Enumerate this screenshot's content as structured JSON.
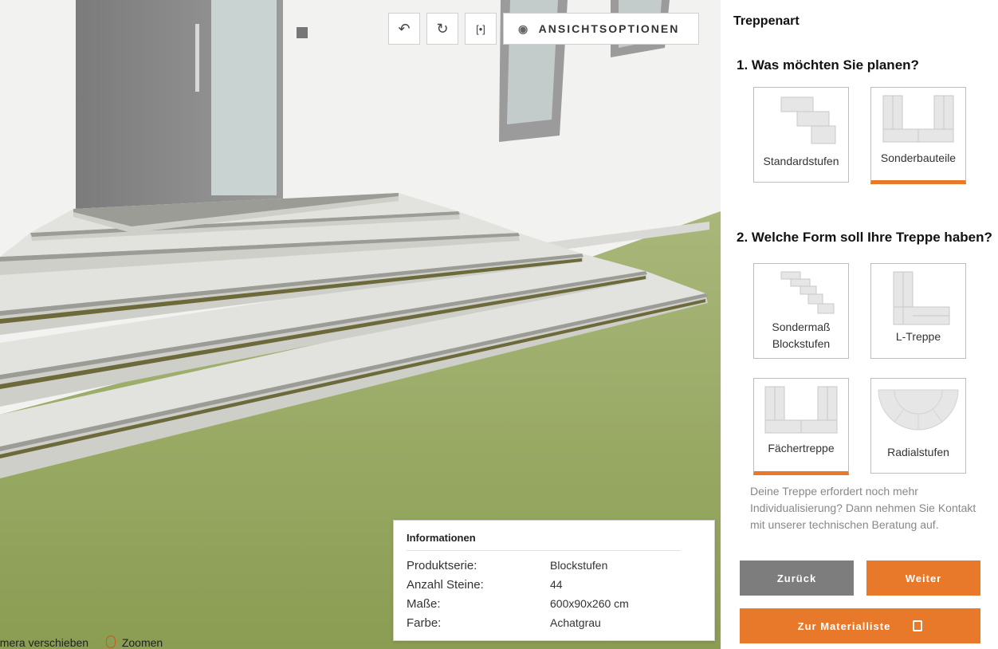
{
  "toolbar": {
    "ansicht_label": "ANSICHTSOPTIONEN",
    "undo_icon": "undo-icon",
    "redo_icon": "redo-icon",
    "fit_icon": "fit-view-icon",
    "eye_icon": "eye-icon"
  },
  "info": {
    "title": "Informationen",
    "rows": [
      {
        "key": "Produktserie:",
        "value": "Blockstufen"
      },
      {
        "key": "Anzahl Steine:",
        "value": "44"
      },
      {
        "key": "Maße:",
        "value": "600x90x260 cm"
      },
      {
        "key": "Farbe:",
        "value": "Achatgrau"
      }
    ]
  },
  "hint": {
    "pan": "amera verschieben",
    "zoom": "Zoomen"
  },
  "sidebar": {
    "title": "Treppenart",
    "q1": "1. Was möchten Sie planen?",
    "q1_options": [
      {
        "label": "Standardstufen",
        "selected": false
      },
      {
        "label": "Sonderbauteile",
        "selected": true
      }
    ],
    "q2": "2. Welche Form soll Ihre Treppe haben?",
    "q2_options": [
      {
        "label": "Sondermaß Blockstufen",
        "label_line1": "Sondermaß",
        "label_line2": "Blockstufen",
        "selected": false
      },
      {
        "label": "L-Treppe",
        "selected": false
      },
      {
        "label": "Fächertreppe",
        "selected": true
      },
      {
        "label": "Radialstufen",
        "selected": false
      }
    ],
    "note": "Deine Treppe erfordert noch mehr Individualisierung? Dann nehmen Sie Kontakt mit unserer technischen Beratung auf.",
    "back_label": "Zurück",
    "next_label": "Weiter",
    "material_label": "Zur Materialliste"
  },
  "colors": {
    "accent": "#e8782a",
    "back_button": "#7d7d7d",
    "grass": "#8ea35a"
  }
}
